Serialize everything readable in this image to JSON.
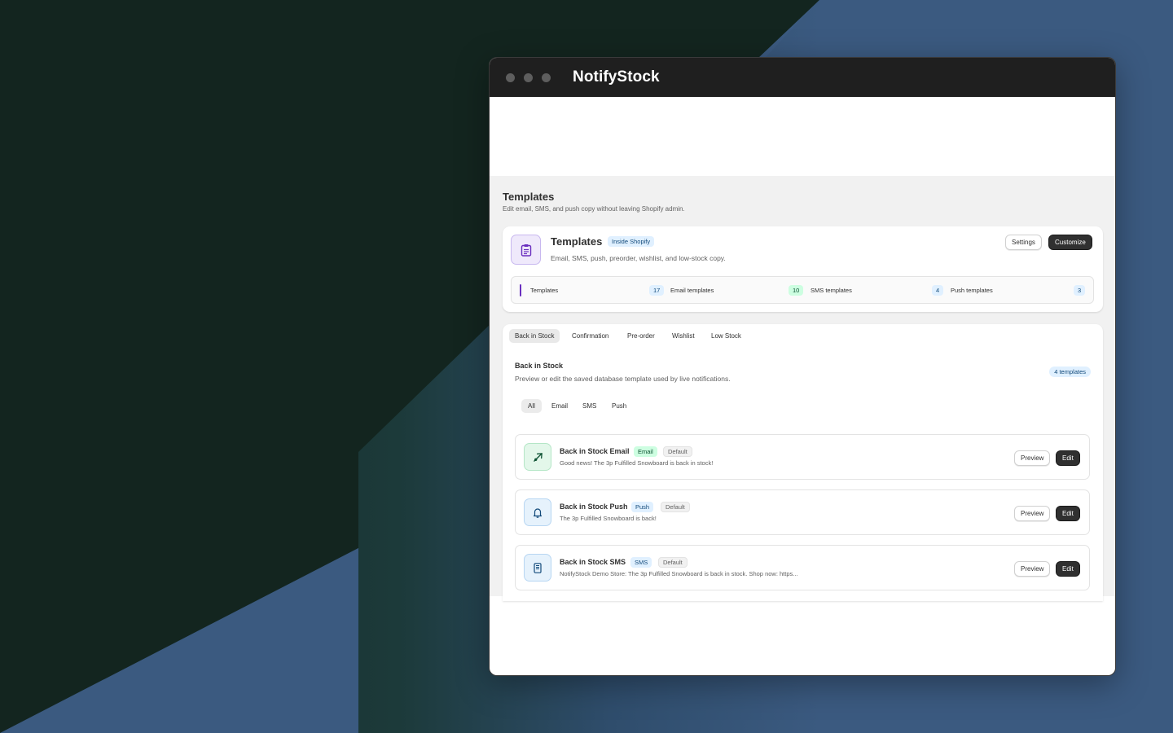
{
  "window": {
    "title": "NotifyStock"
  },
  "page": {
    "title": "Templates",
    "subtitle": "Edit email, SMS, and push copy without leaving Shopify admin."
  },
  "overview": {
    "icon": "clipboard-icon",
    "title": "Templates",
    "badge": "Inside Shopify",
    "description": "Email, SMS, push, preorder, wishlist, and low-stock copy.",
    "settings_label": "Settings",
    "customize_label": "Customize",
    "stats": [
      {
        "label": "Templates",
        "count": "17",
        "color": "#e0f0ff"
      },
      {
        "label": "Email templates",
        "count": "10",
        "color": "#cdfee1"
      },
      {
        "label": "SMS templates",
        "count": "4",
        "color": "#e0f0ff"
      },
      {
        "label": "Push templates",
        "count": "3",
        "color": "#e0f0ff"
      }
    ]
  },
  "tabs": [
    "Back in Stock",
    "Confirmation",
    "Pre-order",
    "Wishlist",
    "Low Stock"
  ],
  "section": {
    "title": "Back in Stock",
    "description": "Preview or edit the saved database template used by live notifications.",
    "count_badge": "4 templates"
  },
  "filters": [
    "All",
    "Email",
    "SMS",
    "Push"
  ],
  "templates": [
    {
      "name": "Back in Stock Email",
      "channel": "Email",
      "channel_color": "#cdfee1",
      "channel_text_color": "#0c5132",
      "default_label": "Default",
      "preview": "Good news! The 3p Fulfilled Snowboard is back in stock!",
      "icon": "send-icon",
      "preview_label": "Preview",
      "edit_label": "Edit"
    },
    {
      "name": "Back in Stock Push",
      "channel": "Push",
      "channel_color": "#e0f0ff",
      "channel_text_color": "#124a7a",
      "default_label": "Default",
      "preview": "The 3p Fulfilled Snowboard is back!",
      "icon": "bell-icon",
      "preview_label": "Preview",
      "edit_label": "Edit"
    },
    {
      "name": "Back in Stock SMS",
      "channel": "SMS",
      "channel_color": "#e0f0ff",
      "channel_text_color": "#124a7a",
      "default_label": "Default",
      "preview": "NotifyStock Demo Store: The 3p Fulfilled Snowboard is back in stock. Shop now: https...",
      "icon": "phone-icon",
      "preview_label": "Preview",
      "edit_label": "Edit"
    }
  ]
}
